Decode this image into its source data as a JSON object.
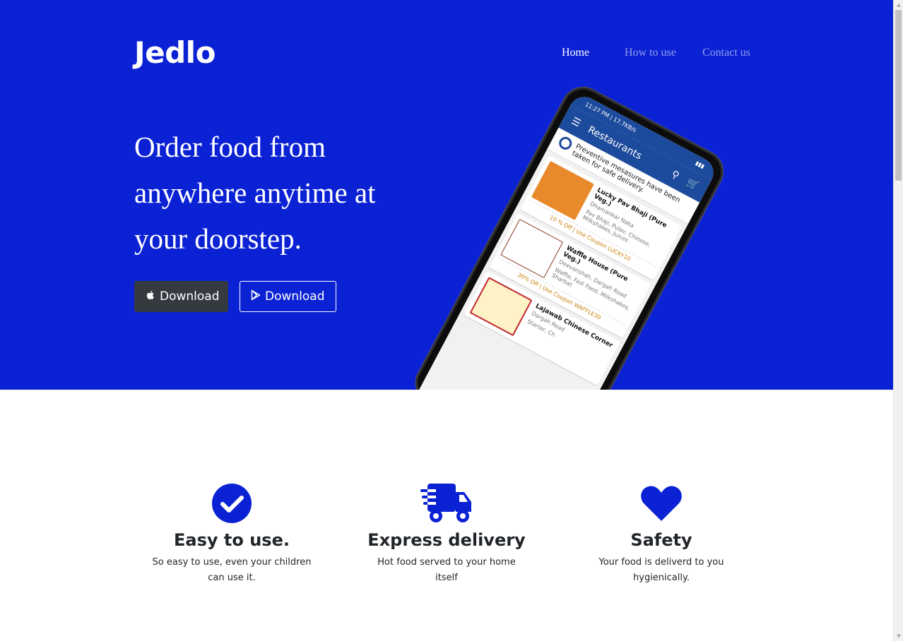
{
  "brand": "Jedlo",
  "nav": {
    "items": [
      {
        "label": "Home",
        "active": true
      },
      {
        "label": "How to use",
        "active": false
      },
      {
        "label": "Contact us",
        "active": false
      }
    ]
  },
  "hero": {
    "headline_lines": [
      "Order food from",
      "anywhere anytime at",
      "your doorstep."
    ],
    "buttons": [
      {
        "label": "Download",
        "icon": "apple-icon",
        "style": "dark"
      },
      {
        "label": "Download",
        "icon": "google-play-icon",
        "style": "outline"
      }
    ]
  },
  "phone": {
    "status_time": "11:27 PM | 17.7KB/s",
    "app_title": "Restaurants",
    "notice": "Preventive mesasures have been taken for safe delivery.",
    "restaurants": [
      {
        "name": "Lucky Pav Bhaji (Pure Veg.)",
        "address": "Dhamankar Naka",
        "tags": "Pav Bhaji, Pulav, Chinese, Milkshakes, Juices",
        "offer": "10 % Off | Use Coupon LUCKY10"
      },
      {
        "name": "Waffle House (Pure Veg.)",
        "address": "Deevanshah, Dargah Road",
        "tags": "Waffle, Fast Food, Milkshakes, Sharbat",
        "offer": "30% Off | Use Coupon WAFFLE30"
      },
      {
        "name": "Lajawab Chinese Corner",
        "address": "Dargah Road",
        "tags": "Starter, Ch",
        "offer": ""
      }
    ]
  },
  "features": [
    {
      "icon": "check-circle-icon",
      "title": "Easy to use.",
      "text": "So easy to use, even your children can use it."
    },
    {
      "icon": "delivery-truck-icon",
      "title": "Express delivery",
      "text": "Hot food served to your home itself"
    },
    {
      "icon": "heart-icon",
      "title": "Safety",
      "text": "Your food is deliverd to you hygienically."
    }
  ],
  "colors": {
    "hero_bg": "#0b22d4",
    "accent": "#0b22d4",
    "dark_button": "#343a40",
    "app_bar": "#1c4a9c"
  }
}
